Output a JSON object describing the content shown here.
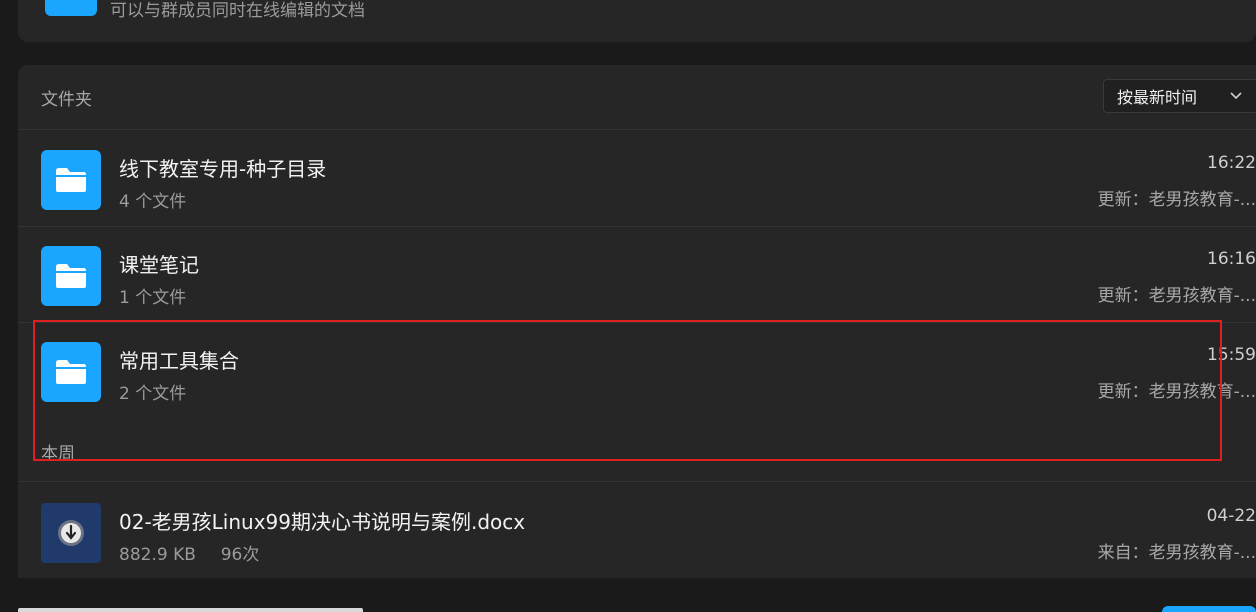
{
  "top_card": {
    "subtitle": "可以与群成员同时在线编辑的文档"
  },
  "folders_section": {
    "title": "文件夹",
    "sort": {
      "selected": "按最新时间"
    },
    "folders": [
      {
        "name": "线下教室专用-种子目录",
        "count": "4 个文件",
        "time": "16:22",
        "updater": "更新：老男孩教育-..."
      },
      {
        "name": "课堂笔记",
        "count": "1 个文件",
        "time": "16:16",
        "updater": "更新：老男孩教育-..."
      },
      {
        "name": "常用工具集合",
        "count": "2 个文件",
        "time": "15:59",
        "updater": "更新：老男孩教育-..."
      }
    ]
  },
  "this_week": {
    "label": "本周",
    "files": [
      {
        "name": "02-老男孩Linux99期决心书说明与案例.docx",
        "size": "882.9 KB",
        "downloads": "96次",
        "time": "04-22",
        "source": "来自：老男孩教育-..."
      }
    ]
  },
  "colors": {
    "accent_blue": "#1aa6ff",
    "highlight_red": "#e02020",
    "doc_blue": "#1f3a6b"
  },
  "icons": {
    "folder": "folder-icon",
    "document": "word-doc-icon",
    "sort_caret": "chevron-down-icon"
  }
}
